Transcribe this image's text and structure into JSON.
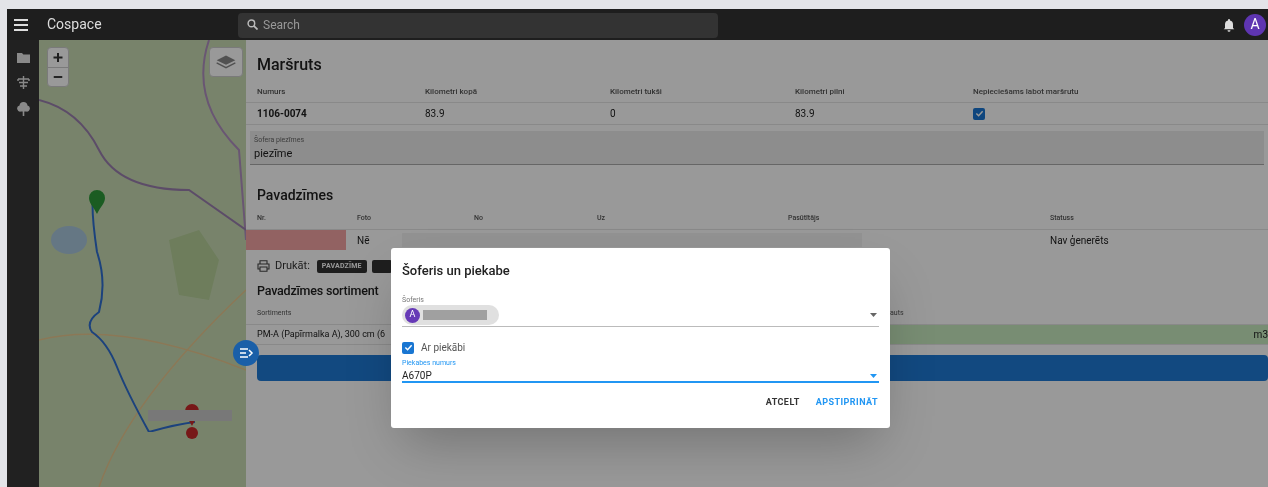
{
  "app": {
    "title": "Cospace",
    "search_placeholder": "Search",
    "avatar": "A"
  },
  "route": {
    "title": "Maršruts",
    "columns": [
      "Numurs",
      "Kilometri kopā",
      "Kilometri tukši",
      "Kilometri pilni",
      "Nepieciešams labot maršrutu"
    ],
    "row": {
      "cells": [
        "1106-0074",
        "83.9",
        "0",
        "83.9"
      ],
      "needs_fix_checked": true
    },
    "notes": {
      "label": "Šofera piezīmes",
      "value": "piezīme"
    }
  },
  "waybills": {
    "title": "Pavadzīmes",
    "columns": [
      "Nr.",
      "Foto",
      "No",
      "Uz",
      "Pasūtītājs",
      "Statuss"
    ],
    "row": {
      "nr_flagged": true,
      "foto": "Nē",
      "status": "Nav ģenerēts"
    }
  },
  "print": {
    "label": "Drukāt:",
    "buttons": [
      {
        "label": "PAVADZĪME"
      }
    ]
  },
  "assortment": {
    "title": "Pavadzīmes sortiment",
    "columns": [
      "Sortiments",
      "auts"
    ],
    "row": {
      "name": "PM-A (Papīrmalka A), 300 cm (6",
      "unit": "m3"
    }
  },
  "dialog": {
    "title": "Šoferis un piekabe",
    "driver": {
      "label": "Šoferis",
      "avatar": "A"
    },
    "trailer_checkbox": {
      "label": "Ar piekābi",
      "checked": true
    },
    "trailer_number": {
      "label": "Piekabes numurs",
      "value": "A670P",
      "focused": true
    },
    "buttons": [
      {
        "label": "ATCELT",
        "kind": "secondary"
      },
      {
        "label": "APSTIPRINĀT",
        "kind": "primary"
      }
    ]
  }
}
